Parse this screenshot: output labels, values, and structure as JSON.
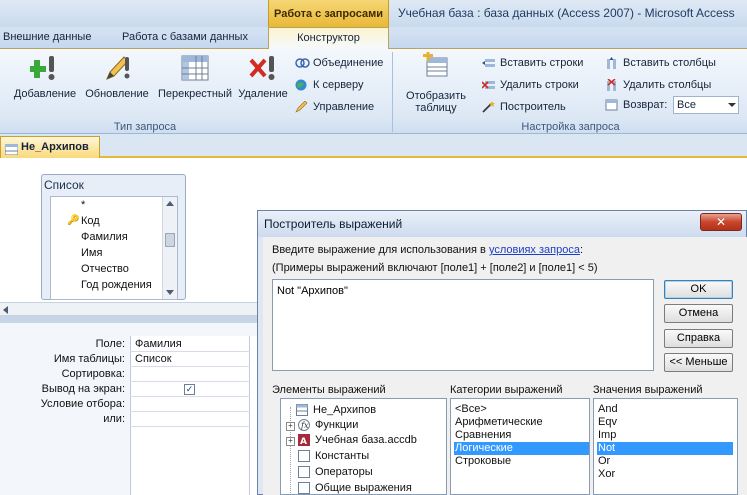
{
  "ribbon": {
    "context_header": "Работа с запросами",
    "window_title": "Учебная база : база данных (Access 2007)  -  Microsoft Access",
    "tabs": [
      {
        "label": "Внешние данные"
      },
      {
        "label": "Работа с базами данных"
      },
      {
        "label": "Конструктор",
        "active": true
      }
    ],
    "query_type_group": {
      "label": "Тип запроса",
      "buttons": [
        {
          "label": "Добавление"
        },
        {
          "label": "Обновление"
        },
        {
          "label": "Перекрестный"
        },
        {
          "label": "Удаление"
        }
      ],
      "small_buttons": [
        {
          "label": "Объединение"
        },
        {
          "label": "К серверу"
        },
        {
          "label": "Управление"
        }
      ]
    },
    "setup_group": {
      "label": "Настройка запроса",
      "show_table": "Отобразить таблицу",
      "show_table_line1": "Отобразить",
      "show_table_line2": "таблицу",
      "insert_rows": "Вставить строки",
      "delete_rows": "Удалить строки",
      "builder": "Построитель",
      "insert_cols": "Вставить столбцы",
      "delete_cols": "Удалить столбцы",
      "return_label": "Возврат:",
      "return_value": "Все"
    }
  },
  "document": {
    "tab_label": "Не_Архипов"
  },
  "table_box": {
    "title": "Список",
    "fields": [
      "*",
      "Код",
      "Фамилия",
      "Имя",
      "Отчество",
      "Год рождения"
    ]
  },
  "qbe_grid": {
    "row_labels": [
      "Поле:",
      "Имя таблицы:",
      "Сортировка:",
      "Вывод на экран:",
      "Условие отбора:",
      "или:"
    ],
    "column": {
      "field": "Фамилия",
      "table": "Список",
      "show": true
    }
  },
  "dialog": {
    "title": "Построитель выражений",
    "instruction_prefix": "Введите выражение для использования в ",
    "instruction_link": "условиях запроса",
    "instruction_suffix": ":",
    "examples": "(Примеры выражений включают [поле1] + [поле2] и [поле1] < 5)",
    "expression": "Not \"Архипов\"",
    "buttons": {
      "ok": "OK",
      "cancel": "Отмена",
      "help": "Справка",
      "less": "<< Меньше"
    },
    "elements_header": "Элементы выражений",
    "categories_header": "Категории выражений",
    "values_header": "Значения выражений",
    "elements": [
      {
        "label": "Не_Архипов"
      },
      {
        "label": "Функции"
      },
      {
        "label": "Учебная база.accdb"
      },
      {
        "label": "Константы"
      },
      {
        "label": "Операторы"
      },
      {
        "label": "Общие выражения"
      }
    ],
    "categories": [
      "<Все>",
      "Арифметические",
      "Сравнения",
      "Логические",
      "Строковые"
    ],
    "categories_selected": "Логические",
    "values": [
      "And",
      "Eqv",
      "Imp",
      "Not",
      "Or",
      "Xor"
    ],
    "values_selected": "Not"
  },
  "colors": {
    "context_tab": "#e9b837",
    "selection": "#3399ff",
    "close_button": "#c9452b"
  }
}
